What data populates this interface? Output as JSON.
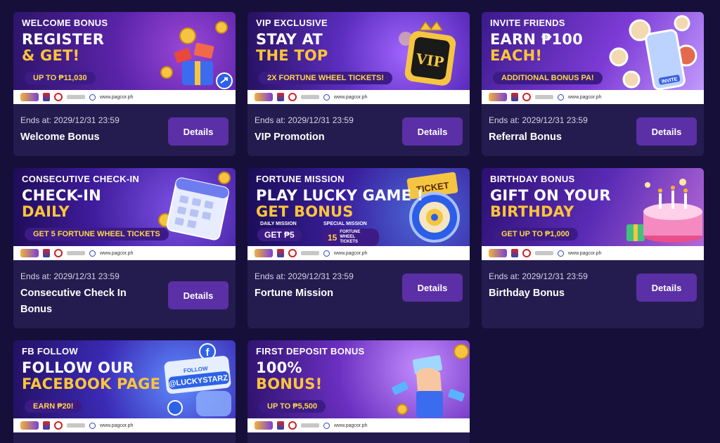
{
  "cards": [
    {
      "tag": "WELCOME BONUS",
      "headline": [
        "REGISTER",
        "& GET!"
      ],
      "pill": "UP TO ₱11,030",
      "site": "www.pagcor.ph",
      "ends": "Ends at: 2029/12/31 23:59",
      "title": "Welcome Bonus",
      "button": "Details",
      "art": "gift-box-coins"
    },
    {
      "tag": "VIP EXCLUSIVE",
      "headline": [
        "STAY AT",
        "THE TOP"
      ],
      "pill": "2X FORTUNE WHEEL TICKETS!",
      "site": "www.pagcor.ph",
      "ends": "Ends at: 2029/12/31 23:59",
      "title": "VIP Promotion",
      "button": "Details",
      "art": "vip-crown-badge",
      "art_text": "VIP"
    },
    {
      "tag": "INVITE FRIENDS",
      "headline": [
        "EARN ₱100",
        "EACH!"
      ],
      "pill": "ADDITIONAL BONUS PA!",
      "site": "www.pagcor.ph",
      "ends": "Ends at: 2029/12/31 23:59",
      "title": "Referral Bonus",
      "button": "Details",
      "art": "phone-invite",
      "art_text": "INVITE"
    },
    {
      "tag": "CONSECUTIVE CHECK-IN",
      "headline": [
        "CHECK-IN",
        "DAILY"
      ],
      "pill": "GET 5 FORTUNE WHEEL TICKETS",
      "site": "www.pagcor.ph",
      "ends": "Ends at: 2029/12/31 23:59",
      "title": "Consecutive Check In Bonus",
      "button": "Details",
      "art": "calendar"
    },
    {
      "tag": "FORTUNE MISSION",
      "headline": [
        "PLAY LUCKY GAME !",
        "GET BONUS"
      ],
      "daily_label": "DAILY MISSION",
      "daily_value": "GET ₱5",
      "special_label": "SPECIAL MISSION",
      "special_value": "15",
      "special_sub": "FORTUNE WHEEL TICKETS",
      "site": "www.pagcor.ph",
      "ends": "Ends at: 2029/12/31 23:59",
      "title": "Fortune Mission",
      "button": "Details",
      "art": "ticket-target",
      "art_text": "TICKET"
    },
    {
      "tag": "BIRTHDAY BONUS",
      "headline": [
        "GIFT ON YOUR",
        "BIRTHDAY"
      ],
      "pill": "GET UP TO ₱1,000",
      "site": "www.pagcor.ph",
      "ends": "Ends at: 2029/12/31 23:59",
      "title": "Birthday Bonus",
      "button": "Details",
      "art": "birthday-cake"
    },
    {
      "tag": "FB FOLLOW",
      "headline": [
        "FOLLOW OUR",
        "FACEBOOK PAGE"
      ],
      "pill": "EARN ₱20!",
      "follow_label": "FOLLOW",
      "handle": "@LUCKYSTARZ",
      "site": "www.pagcor.ph",
      "art": "facebook-bubble"
    },
    {
      "tag": "FIRST DEPOSIT BONUS",
      "headline": [
        "100%",
        "BONUS!"
      ],
      "pill": "UP TO ₱5,500",
      "site": "www.pagcor.ph",
      "art": "hand-cash"
    }
  ],
  "colors": {
    "page_bg": "#150f3a",
    "card_bg": "#241c4e",
    "button_bg": "#5b2fa6",
    "accent_yellow": "#ffc43a"
  }
}
